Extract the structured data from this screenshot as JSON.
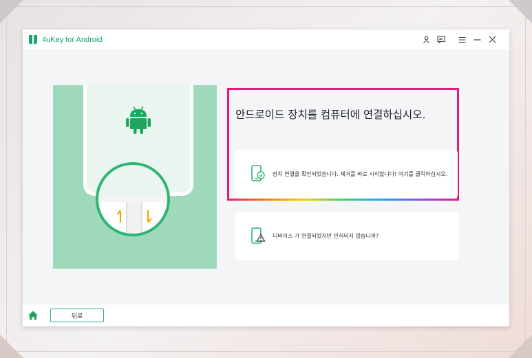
{
  "window": {
    "app_title": "4uKey for Android"
  },
  "titlebar_icons": [
    "user-icon",
    "feedback-icon",
    "menu-icon",
    "minimize-icon",
    "close-icon"
  ],
  "main": {
    "title": "안드로이드 장치를 컴퓨터에 연결하십시오.",
    "card_confirmed_text": "장치 연결을 확인되었습니다. 제거를 바로 시작합니다! 여기를 클릭하십시오.",
    "card_not_recognized_text": "디바이스 가 연결되었지만 인식되지 않습니까?"
  },
  "bottom": {
    "back_label": "뒤로"
  },
  "colors": {
    "brand_green": "#2bb673",
    "highlight_pink": "#e8177d",
    "illustration_bg": "#9fd9bb"
  }
}
